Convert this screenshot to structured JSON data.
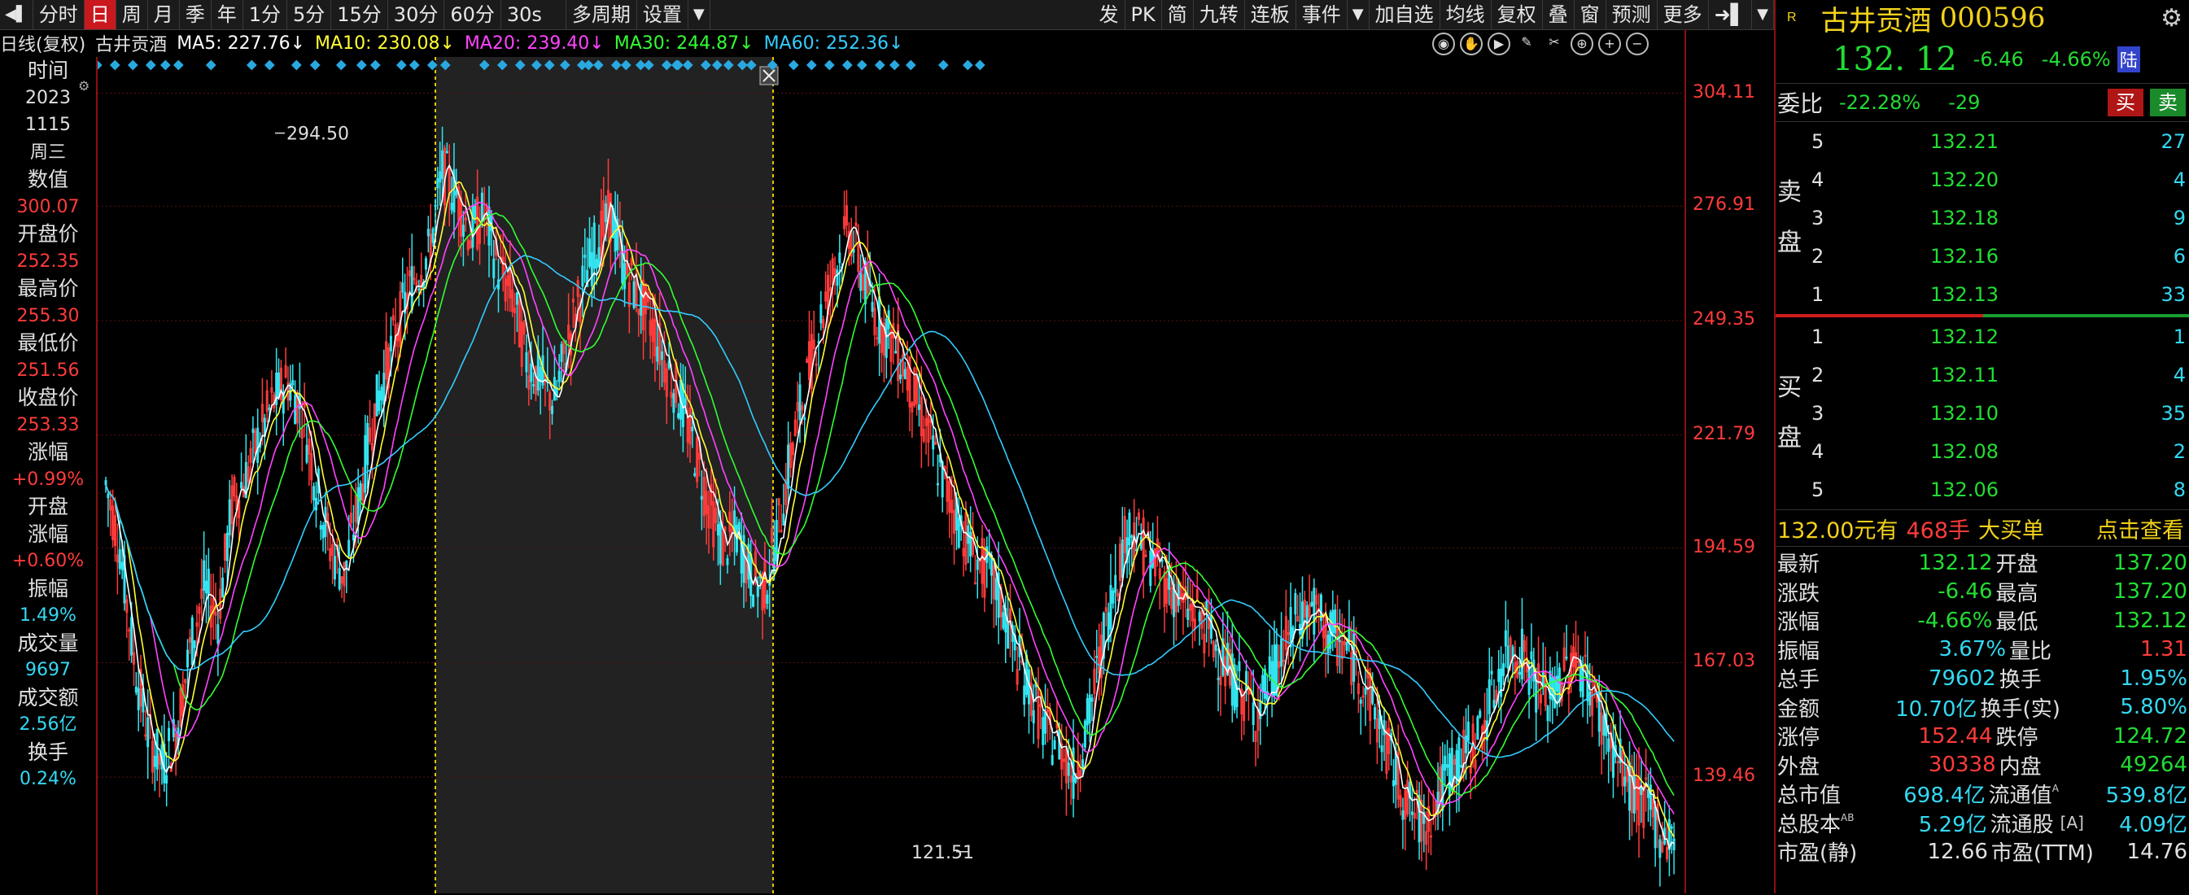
{
  "toolbar": {
    "left": [
      "分时",
      "日",
      "周",
      "月",
      "季",
      "年",
      "1分",
      "5分",
      "15分",
      "30分",
      "60分",
      "30s",
      "多周期",
      "设置"
    ],
    "active_index": 1,
    "right": [
      "发",
      "PK",
      "简",
      "九转",
      "连板",
      "事件",
      "加自选",
      "均线",
      "复权",
      "叠",
      "窗",
      "预测",
      "更多"
    ]
  },
  "ma_line": {
    "period": "日线(复权)",
    "stock": "古井贡酒",
    "ma5": "MA5: 227.76↓",
    "ma10": "MA10: 230.08↓",
    "ma20": "MA20: 239.40↓",
    "ma30": "MA30: 244.87↓",
    "ma60": "MA60: 252.36↓"
  },
  "colors": {
    "ma5": "#ffffff",
    "ma10": "#ffff33",
    "ma20": "#ff44ff",
    "ma30": "#33ff33",
    "ma60": "#33ccff",
    "up": "#ff3b3b",
    "down": "#33e5f0",
    "accent_red": "#c9181e",
    "green": "#22dd33"
  },
  "info_panel": [
    {
      "label": "时间"
    },
    {
      "value": "2023",
      "style": "white"
    },
    {
      "value": "1115",
      "style": "white"
    },
    {
      "value": "周三",
      "style": "white"
    },
    {
      "label": "数值"
    },
    {
      "value": "300.07",
      "style": "red"
    },
    {
      "label": "开盘价"
    },
    {
      "value": "252.35",
      "style": "red"
    },
    {
      "label": "最高价"
    },
    {
      "value": "255.30",
      "style": "red"
    },
    {
      "label": "最低价"
    },
    {
      "value": "251.56",
      "style": "red"
    },
    {
      "label": "收盘价"
    },
    {
      "value": "253.33",
      "style": "red"
    },
    {
      "label": "涨幅"
    },
    {
      "value": "+0.99%",
      "style": "red"
    },
    {
      "label": "开盘"
    },
    {
      "label": "涨幅"
    },
    {
      "value": "+0.60%",
      "style": "red"
    },
    {
      "label": "振幅"
    },
    {
      "value": "1.49%",
      "style": "cyan"
    },
    {
      "label": "成交量"
    },
    {
      "value": "9697",
      "style": "cyan"
    },
    {
      "label": "成交额"
    },
    {
      "value": "2.56亿",
      "style": "cyan"
    },
    {
      "label": "换手"
    },
    {
      "value": "0.24%",
      "style": "cyan"
    }
  ],
  "y_ticks": [
    "304.11",
    "276.91",
    "249.35",
    "221.79",
    "194.59",
    "167.03",
    "139.46"
  ],
  "chart_annotations": {
    "high": "294.50",
    "low": "121.51"
  },
  "chart_data": {
    "type": "candlestick",
    "period": "daily",
    "ylim": [
      115,
      305
    ],
    "y_tick_values": [
      304.11,
      276.91,
      249.35,
      221.79,
      194.59,
      167.03,
      139.46
    ],
    "close_path": [
      210,
      195,
      168,
      150,
      142,
      150,
      170,
      185,
      178,
      205,
      212,
      222,
      230,
      235,
      228,
      210,
      195,
      188,
      205,
      225,
      238,
      250,
      260,
      265,
      285,
      280,
      270,
      275,
      262,
      255,
      240,
      235,
      230,
      245,
      258,
      268,
      275,
      262,
      255,
      248,
      238,
      230,
      218,
      205,
      195,
      198,
      188,
      185,
      200,
      220,
      235,
      250,
      262,
      272,
      260,
      250,
      245,
      238,
      228,
      218,
      208,
      200,
      192,
      188,
      180,
      168,
      160,
      150,
      148,
      140,
      152,
      170,
      188,
      200,
      195,
      190,
      185,
      180,
      178,
      172,
      165,
      160,
      155,
      162,
      170,
      178,
      180,
      175,
      172,
      168,
      160,
      150,
      140,
      132,
      128,
      135,
      142,
      145,
      150,
      160,
      170,
      170,
      162,
      158,
      165,
      168,
      160,
      150,
      142,
      135,
      132,
      126,
      124
    ],
    "high_label": 294.5,
    "low_label": 121.51
  },
  "right_panel": {
    "badge": "R",
    "name": "古井贡酒",
    "code": "000596",
    "price": "132. 12",
    "change": "-6.46",
    "change_pct": "-4.66%",
    "market": "陆",
    "weibi_label": "委比",
    "weibi": "-22.28%",
    "weicha": "-29",
    "buy_btn": "买",
    "sell_btn": "卖",
    "sell_side_label": [
      "卖",
      "盘"
    ],
    "buy_side_label": [
      "买",
      "盘"
    ],
    "asks": [
      {
        "lvl": "5",
        "price": "132.21",
        "vol": "27"
      },
      {
        "lvl": "4",
        "price": "132.20",
        "vol": "4"
      },
      {
        "lvl": "3",
        "price": "132.18",
        "vol": "9"
      },
      {
        "lvl": "2",
        "price": "132.16",
        "vol": "6"
      },
      {
        "lvl": "1",
        "price": "132.13",
        "vol": "33"
      }
    ],
    "bids": [
      {
        "lvl": "1",
        "price": "132.12",
        "vol": "1"
      },
      {
        "lvl": "2",
        "price": "132.11",
        "vol": "4"
      },
      {
        "lvl": "3",
        "price": "132.10",
        "vol": "35"
      },
      {
        "lvl": "4",
        "price": "132.08",
        "vol": "2"
      },
      {
        "lvl": "5",
        "price": "132.06",
        "vol": "8"
      }
    ],
    "big_order": {
      "amount": "132.00元有",
      "hands": "468手",
      "text": "大买单",
      "link": "点击查看"
    },
    "stats": [
      {
        "k1": "最新",
        "v1": "132.12",
        "c1": "green",
        "k2": "开盘",
        "v2": "137.20",
        "c2": "green"
      },
      {
        "k1": "涨跌",
        "v1": "-6.46",
        "c1": "green",
        "k2": "最高",
        "v2": "137.20",
        "c2": "green"
      },
      {
        "k1": "涨幅",
        "v1": "-4.66%",
        "c1": "green",
        "k2": "最低",
        "v2": "132.12",
        "c2": "green"
      },
      {
        "k1": "振幅",
        "v1": "3.67%",
        "c1": "cyan",
        "k2": "量比",
        "v2": "1.31",
        "c2": "red"
      },
      {
        "k1": "总手",
        "v1": "79602",
        "c1": "cyan",
        "k2": "换手",
        "v2": "1.95%",
        "c2": "cyan"
      },
      {
        "k1": "金额",
        "v1": "10.70亿",
        "c1": "cyan",
        "k2": "换手(实)",
        "v2": "5.80%",
        "c2": "cyan"
      },
      {
        "k1": "涨停",
        "v1": "152.44",
        "c1": "red",
        "k2": "跌停",
        "v2": "124.72",
        "c2": "green"
      },
      {
        "k1": "外盘",
        "v1": "30338",
        "c1": "red",
        "k2": "内盘",
        "v2": "49264",
        "c2": "green"
      },
      {
        "k1": "总市值",
        "v1": "698.4亿",
        "c1": "cyan",
        "k2": "流通值",
        "v2": "539.8亿",
        "c2": "cyan",
        "sup2": "A"
      },
      {
        "k1": "总股本",
        "v1": "5.29亿",
        "c1": "cyan",
        "k2": "流通股",
        "v2": "4.09亿",
        "c2": "cyan",
        "sup1": "AB",
        "mid2": "[A]"
      },
      {
        "k1": "市盈(静)",
        "v1": "12.66",
        "c1": "white",
        "k2": "市盈(TTM)",
        "v2": "14.76",
        "c2": "white"
      }
    ]
  }
}
